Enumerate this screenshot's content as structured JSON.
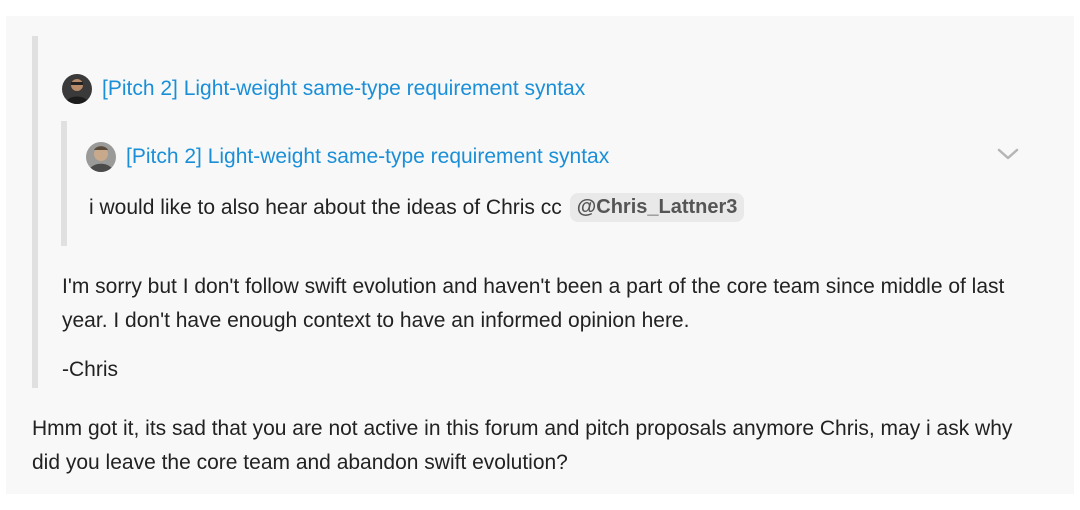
{
  "outer_quote": {
    "title": "[Pitch 2] Light-weight same-type requirement syntax",
    "avatar": "user-avatar-dark"
  },
  "inner_quote": {
    "title": "[Pitch 2] Light-weight same-type requirement syntax",
    "avatar": "user-avatar-light",
    "text": "i would like to also hear about the ideas of Chris cc",
    "mention": "@Chris_Lattner3",
    "toggle_icon": "chevron-down-icon"
  },
  "quoted_reply": {
    "paragraph": "I'm sorry but I don't follow swift evolution and haven't been a part of the core team since middle of last year. I don't have enough context to have an informed opinion here.",
    "signature": "-Chris"
  },
  "post": {
    "body": "Hmm got it, its sad that you are not active in this forum and pitch proposals anymore Chris, may i ask why did you leave the core team and abandon swift evolution?"
  },
  "colors": {
    "link": "#1a8fd8",
    "quote_background": "#f8f8f8",
    "quote_border": "#e0e0e0",
    "text": "#222222"
  }
}
